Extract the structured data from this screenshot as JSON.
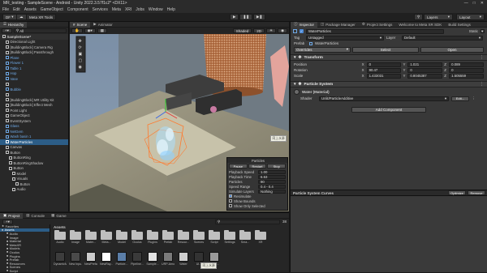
{
  "window": {
    "title": "MR_testing - SampleScene - Android - Unity 2022.3.57f1c2* <DX11>"
  },
  "menu": [
    "File",
    "Edit",
    "Assets",
    "GameObject",
    "Component",
    "Services",
    "Meta",
    "XRI",
    "Jobs",
    "Window",
    "Help"
  ],
  "toolbar": {
    "account": "DF",
    "meta_button": "Meta XR Tools",
    "layers": "Layers",
    "layout": "Layout"
  },
  "hierarchy": {
    "tab": "Hierarchy",
    "search_placeholder": "All",
    "items": [
      {
        "label": "SampleScene*",
        "indent": 0,
        "style": "bold"
      },
      {
        "label": "Directional Light",
        "indent": 1
      },
      {
        "label": "[BuildingBlock] Camera Rig",
        "indent": 1
      },
      {
        "label": "[BuildingBlock] Passthrough",
        "indent": 1
      },
      {
        "label": "Plane",
        "indent": 1,
        "style": "blue"
      },
      {
        "label": "Flower 1",
        "indent": 1,
        "style": "blue"
      },
      {
        "label": "Table 1",
        "indent": 1,
        "style": "blue"
      },
      {
        "label": "Hop",
        "indent": 1,
        "style": "blue"
      },
      {
        "label": "Vase",
        "indent": 1,
        "style": "blue"
      },
      {
        "label": "",
        "indent": 1
      },
      {
        "label": "Bubble",
        "indent": 1,
        "style": "blue"
      },
      {
        "label": "",
        "indent": 1
      },
      {
        "label": "[BuildingBlock] MR Utility Kit",
        "indent": 1
      },
      {
        "label": "[BuildingBlock] Effect Mesh",
        "indent": 1
      },
      {
        "label": "Point Light",
        "indent": 1
      },
      {
        "label": "GameObject",
        "indent": 1
      },
      {
        "label": "EventSystem",
        "indent": 1
      },
      {
        "label": "Glass",
        "indent": 1,
        "style": "blue"
      },
      {
        "label": "NetGem",
        "indent": 1,
        "style": "blue"
      },
      {
        "label": "Wash basin 1",
        "indent": 1,
        "style": "blue"
      },
      {
        "label": "WaterParticles",
        "indent": 1,
        "style": "sel"
      },
      {
        "label": "Canvas",
        "indent": 1
      },
      {
        "label": "Button",
        "indent": 1
      },
      {
        "label": "ButtonRing",
        "indent": 2
      },
      {
        "label": "ButtonRingShadow",
        "indent": 2
      },
      {
        "label": "Button",
        "indent": 2
      },
      {
        "label": "Model",
        "indent": 3
      },
      {
        "label": "Visuals",
        "indent": 3
      },
      {
        "label": "Button",
        "indent": 4
      },
      {
        "label": "Audio",
        "indent": 3
      }
    ]
  },
  "scene": {
    "tabs": [
      "Scene",
      "Animator"
    ],
    "active_tab": "Scene",
    "shading": "Shaded",
    "mode": "2D",
    "label_persp": "< Persp",
    "tooltip": "同上水源"
  },
  "particles_overlay": {
    "title": "Particles",
    "buttons": [
      "Pause",
      "Restart",
      "Stop"
    ],
    "rows": [
      {
        "label": "Playback Speed",
        "value": "1.00"
      },
      {
        "label": "Playback Time",
        "value": "6.53"
      },
      {
        "label": "Particles",
        "value": "90"
      },
      {
        "label": "Speed Range",
        "value": "0.4 - 0.4"
      },
      {
        "label": "Simulate Layers",
        "value": "Nothing"
      }
    ],
    "checks": [
      {
        "label": "Resimulate",
        "checked": true
      },
      {
        "label": "Show Bounds",
        "checked": false
      },
      {
        "label": "Show Only Selected",
        "checked": false
      }
    ]
  },
  "inspector": {
    "tabs": [
      "Inspector",
      "Package Manager",
      "Project Settings",
      "Welcome to Meta XR SDK",
      "Build Settings"
    ],
    "object_name": "WaterParticles",
    "static_label": "Static",
    "tag_label": "Tag",
    "tag_value": "Untagged",
    "layer_label": "Layer",
    "layer_value": "Default",
    "prefab_label": "Prefab",
    "prefab_name": "WaterParticles",
    "prefab_buttons": [
      "Overrides",
      "Select",
      "Open"
    ],
    "transform": {
      "title": "Transform",
      "rows": [
        {
          "label": "Position",
          "x": "0",
          "y": "1.021",
          "z": "0.089"
        },
        {
          "label": "Rotation",
          "x": "90.47",
          "y": "0",
          "z": "0"
        },
        {
          "label": "Scale",
          "x": "1.433031",
          "y": "0.8045387",
          "z": "1.505559"
        }
      ]
    },
    "particle_system": {
      "title": "Particle System",
      "open_editor": "Open Editor..."
    },
    "material": {
      "name": "Water (Material)",
      "shader_label": "Shader",
      "shader_value": "Unlit/ParticleAdditive",
      "edit": "Edit..."
    },
    "add_component": "Add Component",
    "curves": {
      "title": "Particle System Curves",
      "optimize": "Optimize",
      "remove": "Remove"
    }
  },
  "project": {
    "tabs": [
      "Project",
      "Console",
      "Game"
    ],
    "breadcrumb": "Assets",
    "count": "38",
    "tree": [
      "Favorites",
      "Assets",
      "Audio",
      "Image",
      "Material",
      "MetaXR",
      "Models",
      "Oculus",
      "Plugins",
      "Prefab",
      "Resources",
      "Scenes",
      "Script"
    ],
    "row1": [
      "Audio",
      "Image",
      "Mater...",
      "Meta...",
      "Model",
      "Oculus",
      "Plugins",
      "Prefab",
      "Resour...",
      "Scenes",
      "Script",
      "Settings",
      "Sma...",
      "XR"
    ],
    "row2": [
      "DynamicM...",
      "New Inpu...",
      "NewPrefab",
      "NewRay...",
      "Particle...",
      "Pipeline...",
      "Sample...",
      "URP-Amo...",
      "Water",
      "UI...",
      "Water..."
    ],
    "tooltip": "同上水源"
  }
}
